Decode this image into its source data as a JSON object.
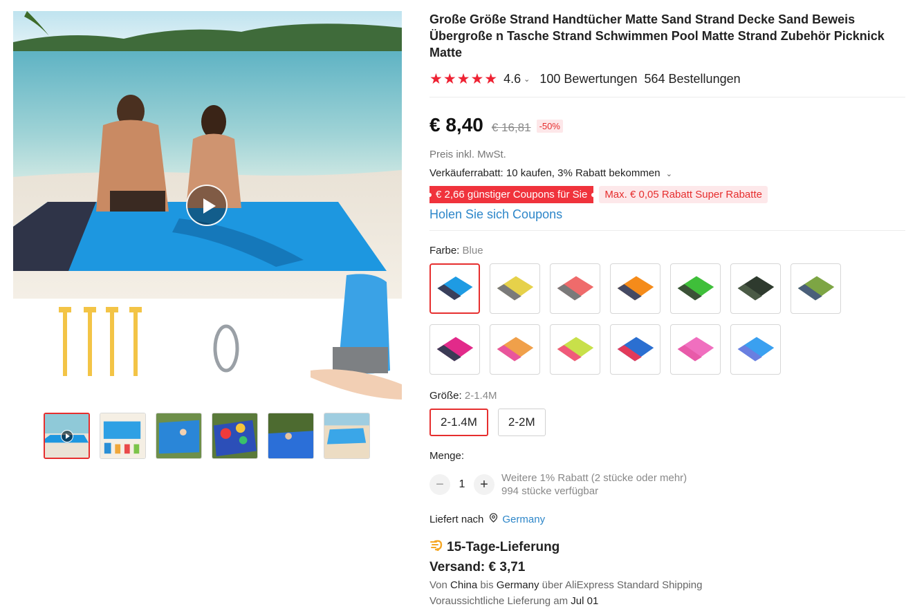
{
  "product": {
    "title": "Große Größe Strand Handtücher Matte Sand Strand Decke Sand Beweis Übergroße n Tasche Strand Schwimmen Pool Matte Strand Zubehör Picknick Matte",
    "stars": "★★★★★",
    "rating": "4.6",
    "reviews": "100 Bewertungen",
    "orders": "564 Bestellungen"
  },
  "price": {
    "current": "€ 8,40",
    "original": "€ 16,81",
    "discount": "-50%",
    "tax_note": "Preis inkl. MwSt.",
    "seller_discount": "Verkäuferrabatt: 10 kaufen, 3% Rabatt bekommen",
    "coupon_main": "€ 2,66 günstiger Coupons für Sie",
    "coupon_super": "Max. € 0,05 Rabatt Super Rabatte",
    "get_coupons": "Holen Sie sich Coupons"
  },
  "color": {
    "label": "Farbe:",
    "selected": "Blue",
    "swatch_colors": [
      [
        "#1e9be3",
        "#3a3f5a"
      ],
      [
        "#e6d14a",
        "#7a7a7a"
      ],
      [
        "#ef6b6b",
        "#7a7a7a"
      ],
      [
        "#f58b1a",
        "#454a63"
      ],
      [
        "#3fbf3a",
        "#3b5137"
      ],
      [
        "#2e3a2e",
        "#4a5a45"
      ],
      [
        "#7da544",
        "#4a5f7a"
      ],
      [
        "#e22a8a",
        "#3b3b55"
      ],
      [
        "#f0a04a",
        "#e9559c"
      ],
      [
        "#c8e04a",
        "#f05a7a"
      ],
      [
        "#2b6fd1",
        "#e23a5a"
      ],
      [
        "#f06fbf",
        "#e85aa9"
      ],
      [
        "#3aa0f0",
        "#6a7fe0"
      ]
    ]
  },
  "size": {
    "label": "Größe:",
    "selected": "2-1.4M",
    "options": [
      "2-1.4M",
      "2-2M"
    ]
  },
  "quantity": {
    "label": "Menge:",
    "minus": "−",
    "value": "1",
    "plus": "+",
    "bulk_note": "Weitere 1% Rabatt (2 stücke oder mehr)",
    "stock_note": "994 stücke verfügbar"
  },
  "shipping": {
    "ship_to_label": "Liefert nach",
    "country": "Germany",
    "delivery_title": "15-Tage-Lieferung",
    "price": "Versand: € 3,71",
    "route_from_prefix": "Von",
    "route_from": "China",
    "route_to_prefix": "bis",
    "route_to": "Germany",
    "route_method": "über AliExpress Standard Shipping",
    "eta_prefix": "Voraussichtliche Lieferung am",
    "eta_date": "Jul 01"
  },
  "colors": {
    "accent_red": "#e62e2e",
    "link_blue": "#2d86c9",
    "star_red": "#ee2233"
  }
}
